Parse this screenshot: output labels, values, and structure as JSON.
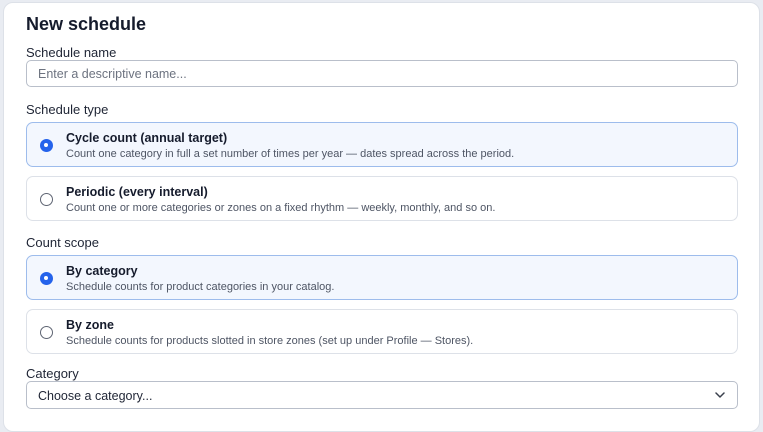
{
  "form": {
    "title": "New schedule",
    "schedule_name": {
      "label": "Schedule name",
      "value": "",
      "placeholder": "Enter a descriptive name..."
    },
    "schedule_type": {
      "label": "Schedule type",
      "selected": "cycle",
      "options": [
        {
          "id": "cycle",
          "title": "Cycle count (annual target)",
          "description": "Count one category in full a set number of times per year — dates spread across the period."
        },
        {
          "id": "periodic",
          "title": "Periodic (every interval)",
          "description": "Count one or more categories or zones on a fixed rhythm — weekly, monthly, and so on."
        }
      ]
    },
    "count_scope": {
      "label": "Count scope",
      "selected": "category",
      "options": [
        {
          "id": "category",
          "title": "By category",
          "description": "Schedule counts for product categories in your catalog."
        },
        {
          "id": "zone",
          "title": "By zone",
          "description": "Schedule counts for products slotted in store zones (set up under Profile — Stores)."
        }
      ]
    },
    "category": {
      "label": "Category",
      "selected_value": "Choose a category...",
      "icon": "chevron-down-icon"
    }
  },
  "colors": {
    "accent": "#2563eb",
    "selected_bg": "#f3f7fe",
    "selected_border": "#9dbcec"
  }
}
